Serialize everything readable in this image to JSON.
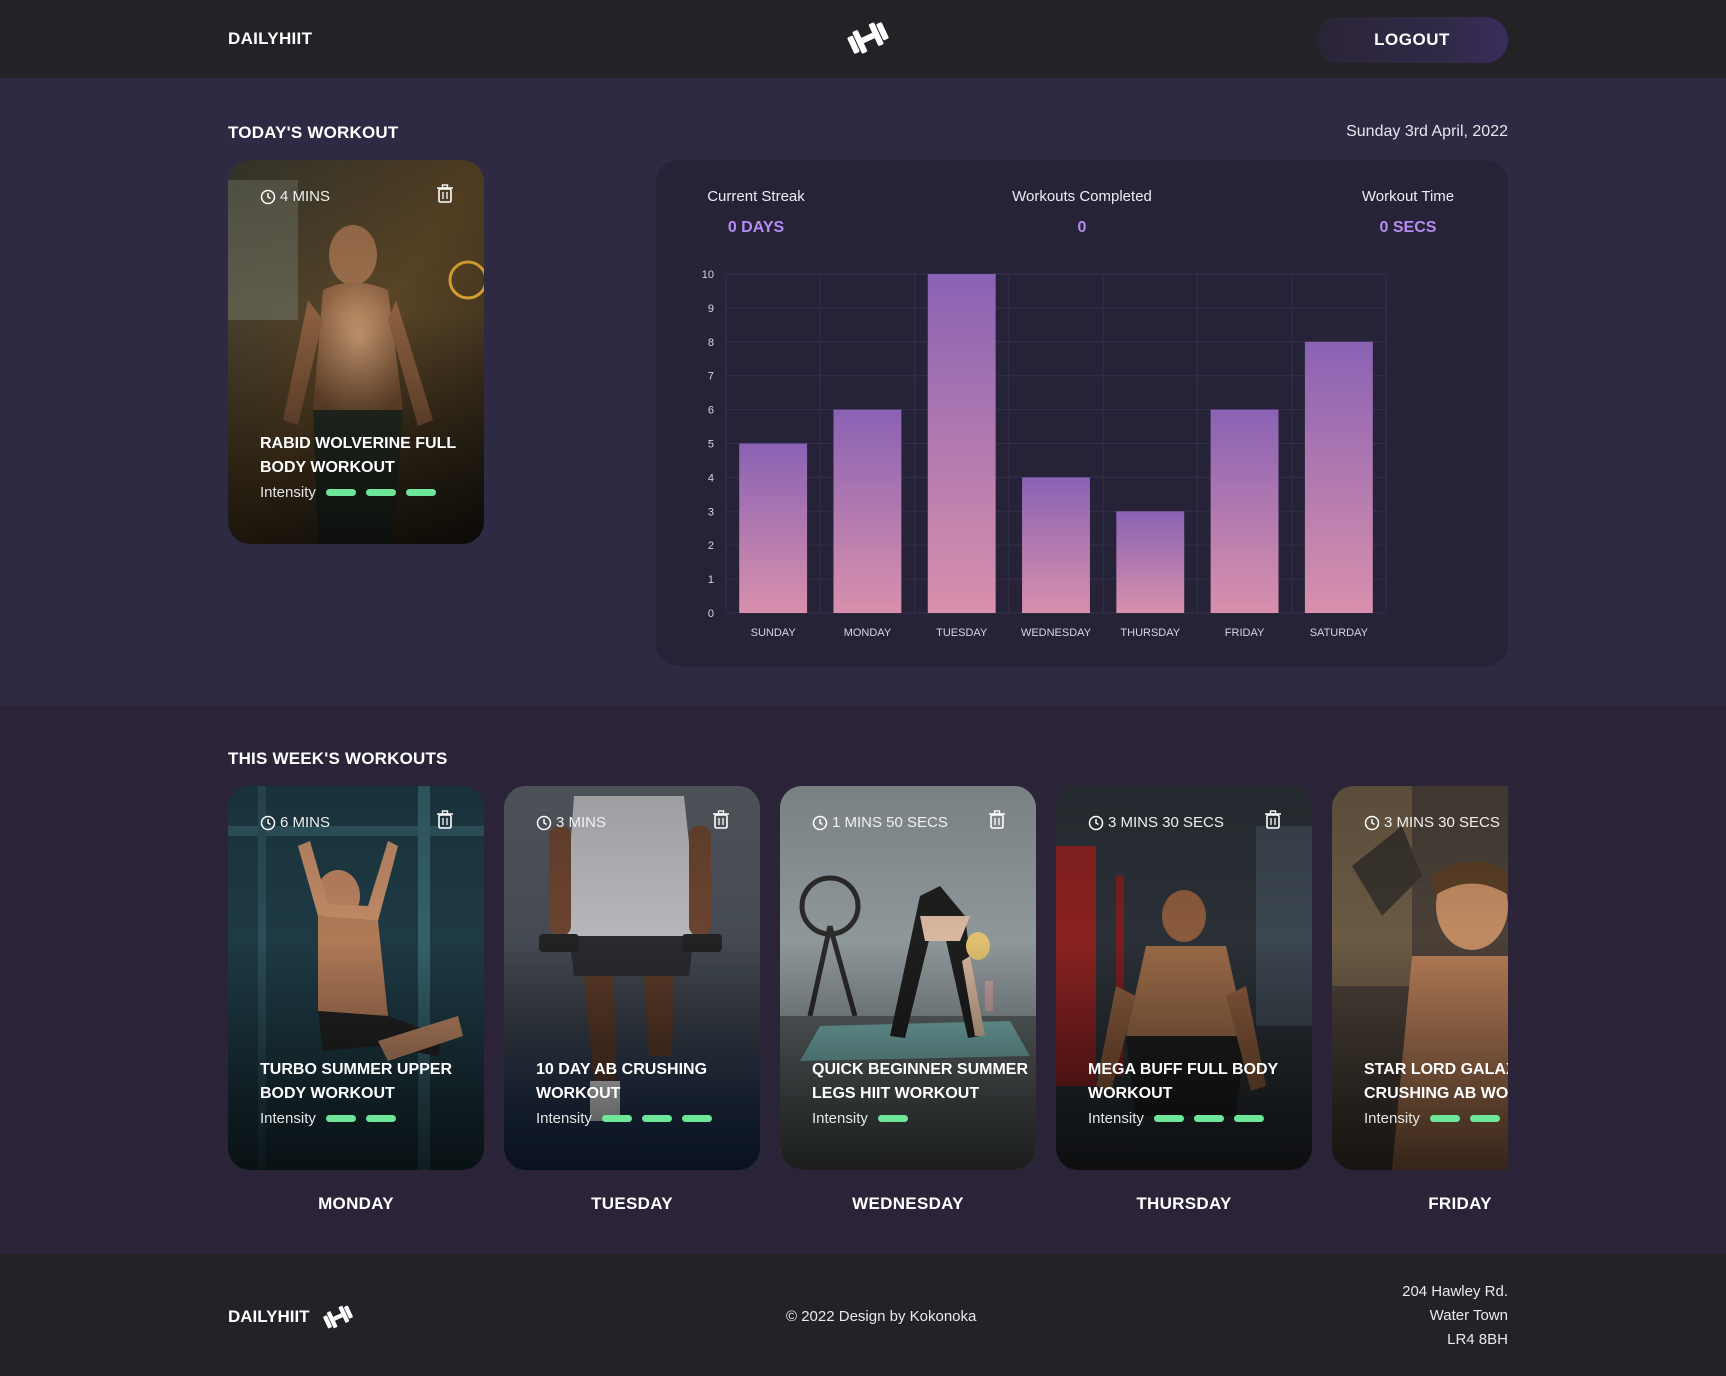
{
  "header": {
    "brand": "DAILYHIIT",
    "logo_icon": "dumbbell-icon",
    "logout_label": "LOGOUT"
  },
  "today": {
    "title": "TODAY'S WORKOUT",
    "date": "Sunday 3rd April, 2022",
    "card": {
      "mins": "4 MINS",
      "title_line1": "RABID WOLVERINE FULL",
      "title_line2": "BODY WORKOUT",
      "intensity_label": "Intensity",
      "intensity_level": 3,
      "clock_icon": "clock-icon",
      "trash_icon": "trash-icon"
    }
  },
  "stats": {
    "streak_label": "Current Streak",
    "streak_value": "0 DAYS",
    "completed_label": "Workouts Completed",
    "completed_value": "0",
    "time_label": "Workout Time",
    "time_value": "0 SECS"
  },
  "chart_data": {
    "type": "bar",
    "categories": [
      "SUNDAY",
      "MONDAY",
      "TUESDAY",
      "WEDNESDAY",
      "THURSDAY",
      "FRIDAY",
      "SATURDAY"
    ],
    "values": [
      5,
      6,
      10,
      4,
      3,
      6,
      8
    ],
    "yticks": [
      "0",
      "1",
      "2",
      "3",
      "4",
      "5",
      "6",
      "7",
      "8",
      "9",
      "10"
    ],
    "ylim": [
      0,
      10
    ],
    "grid": true,
    "bar_color_top": "#8a62b4",
    "bar_color_bottom": "#d890ac"
  },
  "week": {
    "title": "THIS WEEK'S WORKOUTS",
    "cards": [
      {
        "mins": "6 MINS",
        "title_line1": "TURBO SUMMER UPPER",
        "title_line2": "BODY WORKOUT",
        "intensity_label": "Intensity",
        "intensity_level": 2,
        "day": "MONDAY"
      },
      {
        "mins": "3 MINS",
        "title_line1": "10 DAY AB CRUSHING",
        "title_line2": "WORKOUT",
        "intensity_label": "Intensity",
        "intensity_level": 3,
        "day": "TUESDAY"
      },
      {
        "mins": "1 MINS 50 SECS",
        "title_line1": "QUICK BEGINNER SUMMER",
        "title_line2": "LEGS HIIT WORKOUT",
        "intensity_label": "Intensity",
        "intensity_level": 1,
        "day": "WEDNESDAY"
      },
      {
        "mins": "3 MINS 30 SECS",
        "title_line1": "MEGA BUFF FULL BODY",
        "title_line2": "WORKOUT",
        "intensity_label": "Intensity",
        "intensity_level": 3,
        "day": "THURSDAY"
      },
      {
        "mins": "3 MINS 30 SECS",
        "title_line1": "STAR LORD GALAXY",
        "title_line2": "CRUSHING AB WORKOUT",
        "intensity_label": "Intensity",
        "intensity_level": 2,
        "day": "FRIDAY"
      }
    ]
  },
  "footer": {
    "brand": "DAILYHIIT",
    "copyright": "© 2022 Design by Kokonoka",
    "address_line1": "204 Hawley Rd.",
    "address_line2": "Water Town",
    "address_line3": "LR4 8BH"
  },
  "colors": {
    "accent": "#b58cf0",
    "intensity": "#6ee69a",
    "header_bg": "#232226",
    "panel_bg": "#262338"
  }
}
